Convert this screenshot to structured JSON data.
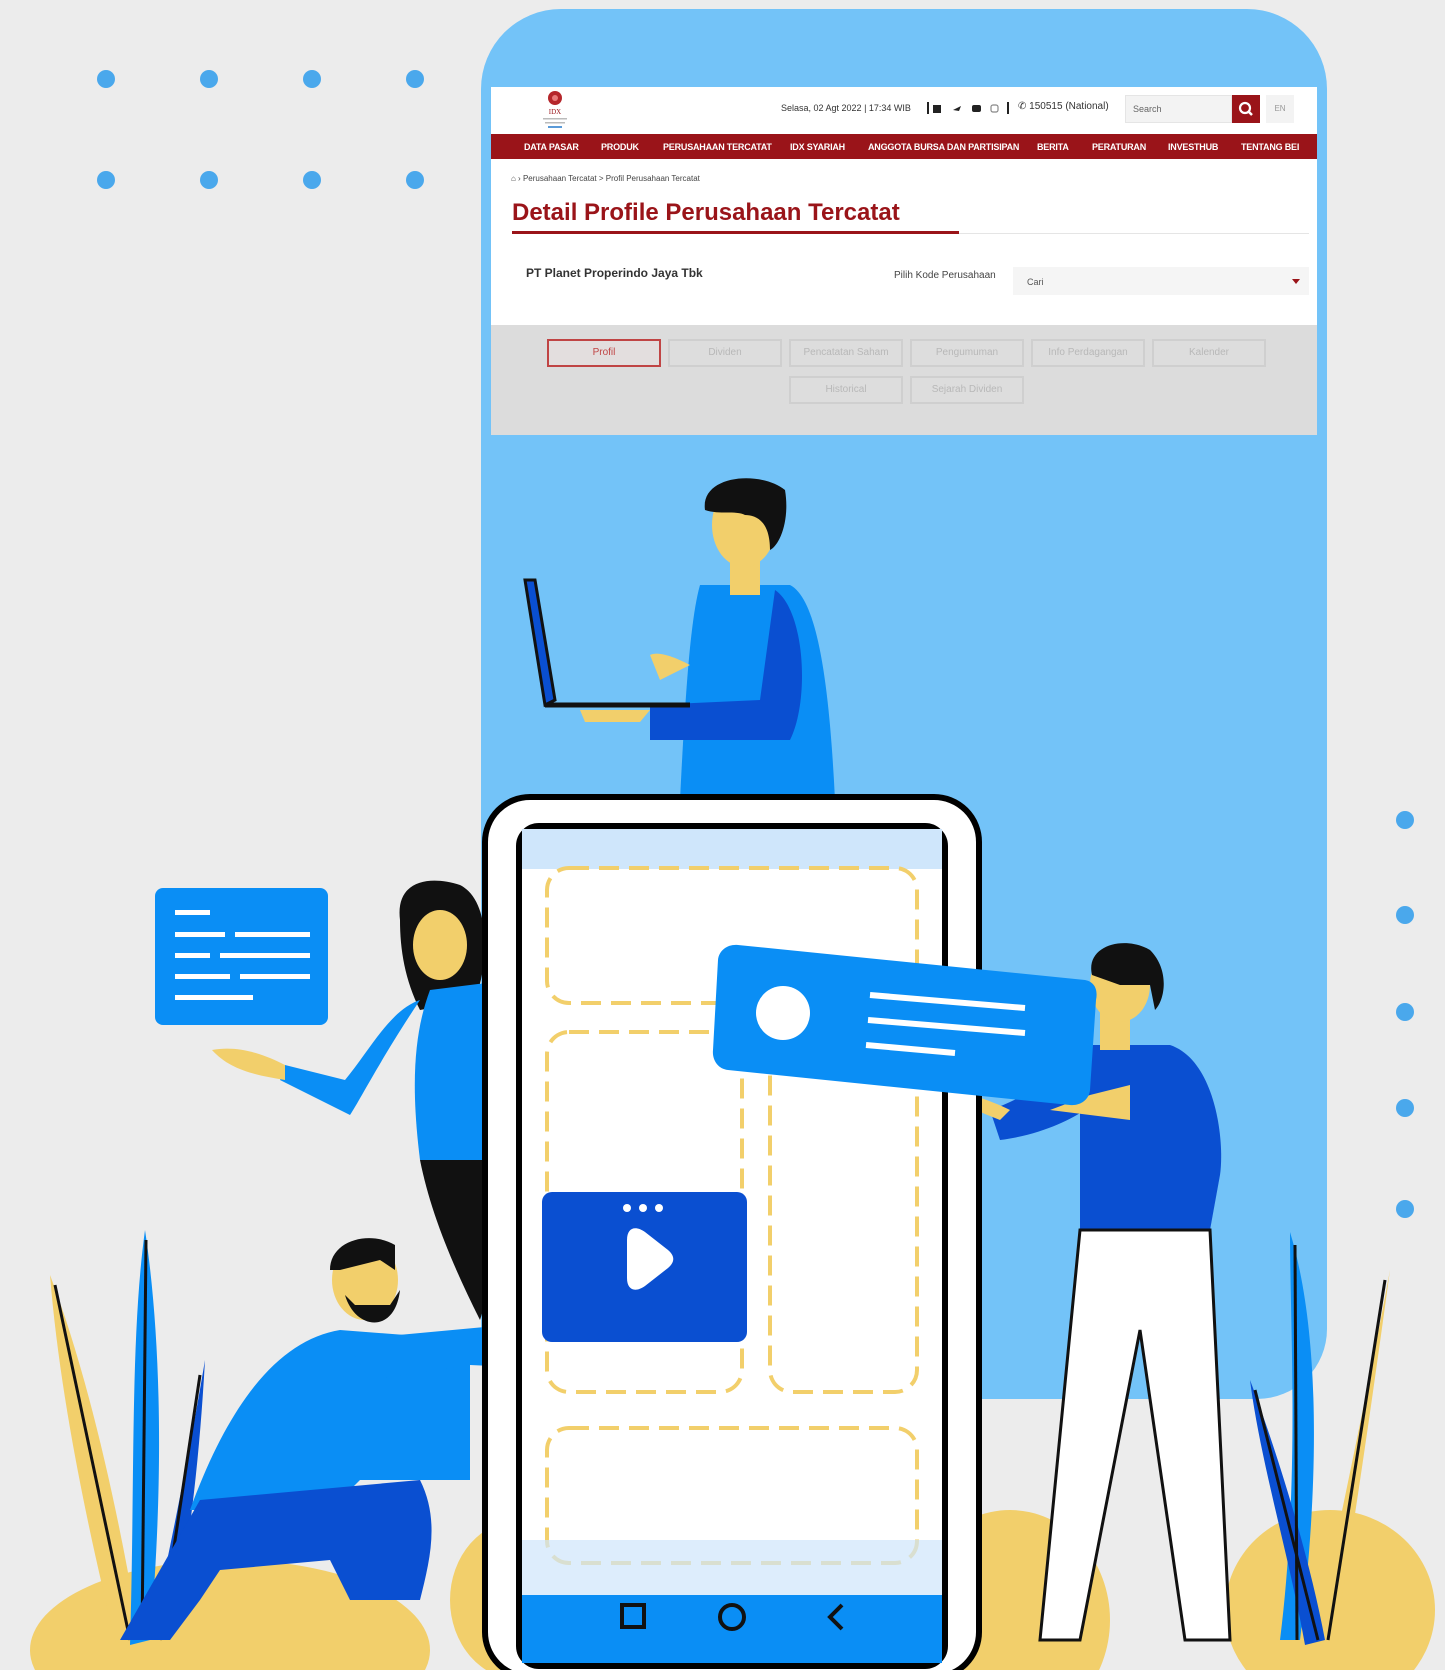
{
  "colors": {
    "background": "#ececec",
    "frame_blue": "#73c3f8",
    "brand_red": "#9a1419",
    "accent_blue": "#0a8ef5",
    "dark_blue": "#0a4fd1",
    "yellow": "#f2cf6b"
  },
  "website": {
    "datetime": "Selasa, 02 Agt 2022 | 17:34 WIB",
    "hotline": "150515 (National)",
    "search_placeholder": "Search",
    "lang_label": "EN",
    "nav": [
      "DATA PASAR",
      "PRODUK",
      "PERUSAHAAN TERCATAT",
      "IDX SYARIAH",
      "ANGGOTA BURSA DAN PARTISIPAN",
      "BERITA",
      "PERATURAN",
      "INVESTHUB",
      "TENTANG BEI"
    ],
    "breadcrumb": "Perusahaan Tercatat  >  Profil Perusahaan Tercatat",
    "page_title": "Detail Profile Perusahaan Tercatat",
    "company_name": "PT Planet Properindo Jaya Tbk",
    "company_select_label": "Pilih Kode Perusahaan",
    "company_select_value": "Cari",
    "tabs": [
      "Profil",
      "Dividen",
      "Pencatatan Saham",
      "Pengumuman",
      "Info Perdagangan",
      "Kalender",
      "Historical",
      "Sejarah Dividen"
    ]
  },
  "illustration": {
    "icons": [
      "laptop-icon",
      "play-icon",
      "square-nav-icon",
      "circle-nav-icon",
      "back-nav-icon",
      "text-card-icon",
      "profile-card-icon"
    ]
  }
}
